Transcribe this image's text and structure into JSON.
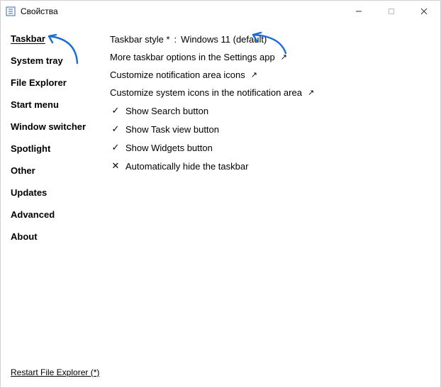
{
  "titlebar": {
    "title": "Свойства"
  },
  "sidebar": {
    "items": [
      {
        "label": "Taskbar"
      },
      {
        "label": "System tray"
      },
      {
        "label": "File Explorer"
      },
      {
        "label": "Start menu"
      },
      {
        "label": "Window switcher"
      },
      {
        "label": "Spotlight"
      },
      {
        "label": "Other"
      },
      {
        "label": "Updates"
      },
      {
        "label": "Advanced"
      },
      {
        "label": "About"
      }
    ]
  },
  "main": {
    "style_row": {
      "label": "Taskbar style *",
      "sep": " : ",
      "value": "Windows 11 (default)"
    },
    "links": {
      "more_options": "More taskbar options in the Settings app",
      "customize_icons": "Customize notification area icons",
      "customize_system_icons": "Customize system icons in the notification area"
    },
    "toggles": {
      "search": {
        "icon": "✓",
        "label": "Show Search button"
      },
      "taskview": {
        "icon": "✓",
        "label": "Show Task view button"
      },
      "widgets": {
        "icon": "✓",
        "label": "Show Widgets button"
      },
      "autohide": {
        "icon": "✕",
        "label": "Automatically hide the taskbar"
      }
    }
  },
  "footer": {
    "restart": "Restart File Explorer (*)"
  },
  "annotation_color": "#1a6bd8"
}
